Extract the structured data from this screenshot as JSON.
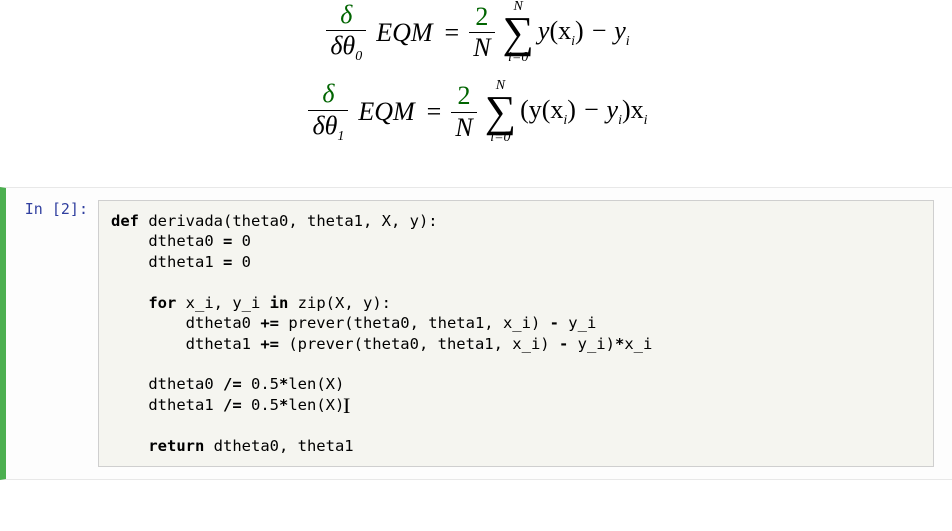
{
  "math": {
    "varSymbol": "δ",
    "denom0": "δθ",
    "sub0": "0",
    "denom1": "δθ",
    "sub1": "1",
    "eqmLabel": "EQM",
    "equals": "=",
    "twoOverN_num": "2",
    "twoOverN_den": "N",
    "sigma_upper": "N",
    "sigma_lower": "i=0",
    "body0_a": "y",
    "body0_b": "(x",
    "body0_c": ")",
    "body0_d": " − y",
    "body1_a": "(y",
    "body1_b": "(x",
    "body1_c": ")",
    "body1_d": " − y",
    "body1_e": ")x",
    "subscript_i": "i"
  },
  "code": {
    "prompt": "In [2]:",
    "l1_kw1": "def",
    "l1_fn": " derivada",
    "l1_rest": "(theta0, theta1, X, y):",
    "l2": "    dtheta0 ",
    "l2_op": "=",
    "l2_num": " 0",
    "l3": "    dtheta1 ",
    "l3_op": "=",
    "l3_num": " 0",
    "l4": "",
    "l5_pre": "    ",
    "l5_for": "for",
    "l5_mid": " x_i, y_i ",
    "l5_in": "in",
    "l5_zip": " zip",
    "l5_rest": "(X, y):",
    "l6": "        dtheta0 ",
    "l6_op": "+=",
    "l6_rest": " prever(theta0, theta1, x_i) ",
    "l6_op2": "-",
    "l6_end": " y_i",
    "l7": "        dtheta1 ",
    "l7_op": "+=",
    "l7_rest": " (prever(theta0, theta1, x_i) ",
    "l7_op2": "-",
    "l7_end": " y_i)",
    "l7_op3": "*",
    "l7_end2": "x_i",
    "l8": "",
    "l9": "    dtheta0 ",
    "l9_op": "/=",
    "l9_num": " 0.5",
    "l9_op2": "*",
    "l9_len": "len",
    "l9_rest": "(X)",
    "l10": "    dtheta1 ",
    "l10_op": "/=",
    "l10_num": " 0.5",
    "l10_op2": "*",
    "l10_len": "len",
    "l10_rest": "(X)",
    "l11": "",
    "l12_pre": "    ",
    "l12_kw": "return",
    "l12_rest": " dtheta0, theta1"
  }
}
